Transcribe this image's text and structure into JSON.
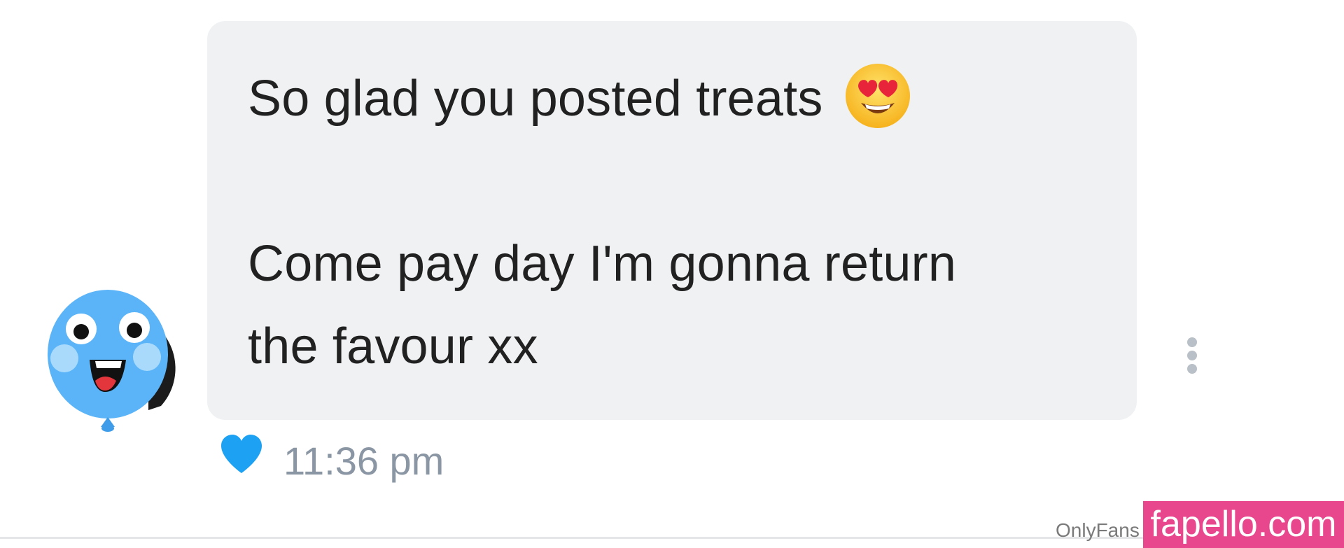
{
  "message": {
    "line1": "So glad you posted treats",
    "emoji": "smiling-face-with-heart-eyes-icon",
    "line2": "Come pay day I'm gonna return",
    "line3": "the favour xx"
  },
  "meta": {
    "timestamp": "11:36 pm",
    "liked": true
  },
  "footer": {
    "platform_label": "OnlyFans",
    "watermark": "fapello.com"
  },
  "colors": {
    "bubble": "#eff1f2",
    "message_text": "#212121",
    "timestamp": "#8a96a3",
    "heart": "#1da1f2",
    "avatar": "#5ab4f7",
    "watermark_bg": "#e8468d"
  }
}
